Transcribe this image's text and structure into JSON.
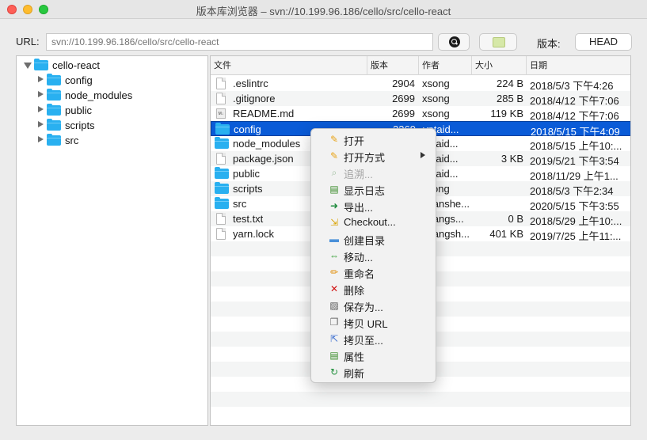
{
  "window": {
    "title": "版本库浏览器 – svn://10.199.96.186/cello/src/cello-react"
  },
  "toolbar": {
    "url_label": "URL:",
    "url_placeholder": "svn://10.199.96.186/cello/src/cello-react",
    "version_label": "版本:",
    "version_value": "HEAD"
  },
  "tree": {
    "root": "cello-react",
    "children": [
      "config",
      "node_modules",
      "public",
      "scripts",
      "src"
    ]
  },
  "list": {
    "columns": [
      "文件",
      "版本",
      "作者",
      "大小",
      "日期"
    ],
    "rows": [
      {
        "name": ".eslintrc",
        "rev": "2904",
        "author": "xsong",
        "size": "224 B",
        "date": "2018/5/3 下午4:26",
        "type": "file"
      },
      {
        "name": ".gitignore",
        "rev": "2699",
        "author": "xsong",
        "size": "285 B",
        "date": "2018/4/12 下午7:06",
        "type": "file"
      },
      {
        "name": "README.md",
        "rev": "2699",
        "author": "xsong",
        "size": "119 KB",
        "date": "2018/4/12 下午7:06",
        "type": "md"
      },
      {
        "name": "config",
        "rev": "3369",
        "author": "yptaid...",
        "size": "",
        "date": "2018/5/15 下午4:09",
        "type": "folder"
      },
      {
        "name": "node_modules",
        "rev": "",
        "author": "yptaid...",
        "size": "",
        "date": "2018/5/15 上午10:...",
        "type": "folder"
      },
      {
        "name": "package.json",
        "rev": "",
        "author": "yptaid...",
        "size": "3 KB",
        "date": "2019/5/21 下午3:54",
        "type": "file"
      },
      {
        "name": "public",
        "rev": "",
        "author": "yptaid...",
        "size": "",
        "date": "2018/11/29 上午1...",
        "type": "folder"
      },
      {
        "name": "scripts",
        "rev": "",
        "author": "xsong",
        "size": "",
        "date": "2018/5/3 下午2:34",
        "type": "folder"
      },
      {
        "name": "src",
        "rev": "",
        "author": "zhanshe...",
        "size": "",
        "date": "2020/5/15 下午3:55",
        "type": "folder"
      },
      {
        "name": "test.txt",
        "rev": "",
        "author": "zhangs...",
        "size": "0 B",
        "date": "2018/5/29 上午10:...",
        "type": "file"
      },
      {
        "name": "yarn.lock",
        "rev": "",
        "author": "zhangsh...",
        "size": "401 KB",
        "date": "2019/7/25 上午11:...",
        "type": "file"
      }
    ]
  },
  "context_menu": {
    "items": [
      {
        "label": "打开",
        "icon": "open-icon",
        "glyph": "✎",
        "color": "#e8a317",
        "disabled": false,
        "submenu": false
      },
      {
        "label": "打开方式",
        "icon": "open-with-icon",
        "glyph": "✎",
        "color": "#e8a317",
        "disabled": false,
        "submenu": true
      },
      {
        "label": "追溯...",
        "icon": "blame-icon",
        "glyph": "⌕",
        "color": "#9fbf9f",
        "disabled": true,
        "submenu": false
      },
      {
        "label": "显示日志",
        "icon": "log-icon",
        "glyph": "▤",
        "color": "#3a8c2a",
        "disabled": false,
        "submenu": false
      },
      {
        "label": "导出...",
        "icon": "export-icon",
        "glyph": "➜",
        "color": "#1d8a3c",
        "disabled": false,
        "submenu": false
      },
      {
        "label": "Checkout...",
        "icon": "checkout-icon",
        "glyph": "⇲",
        "color": "#d9a300",
        "disabled": false,
        "submenu": false
      },
      {
        "label": "创建目录",
        "icon": "create-folder-icon",
        "glyph": "▬",
        "color": "#4a90d9",
        "disabled": false,
        "submenu": false
      },
      {
        "label": "移动...",
        "icon": "move-icon",
        "glyph": "⇔",
        "color": "#2e9b2e",
        "disabled": false,
        "submenu": false
      },
      {
        "label": "重命名",
        "icon": "rename-icon",
        "glyph": "✏",
        "color": "#e08a00",
        "disabled": false,
        "submenu": false
      },
      {
        "label": "删除",
        "icon": "delete-icon",
        "glyph": "✕",
        "color": "#d01010",
        "disabled": false,
        "submenu": false
      },
      {
        "label": "保存为...",
        "icon": "save-as-icon",
        "glyph": "▨",
        "color": "#555555",
        "disabled": false,
        "submenu": false
      },
      {
        "label": "拷贝 URL",
        "icon": "copy-url-icon",
        "glyph": "❐",
        "color": "#6a6a6a",
        "disabled": false,
        "submenu": false
      },
      {
        "label": "拷贝至...",
        "icon": "copy-to-icon",
        "glyph": "⇱",
        "color": "#3c6fd0",
        "disabled": false,
        "submenu": false
      },
      {
        "label": "属性",
        "icon": "properties-icon",
        "glyph": "▤",
        "color": "#3a8c2a",
        "disabled": false,
        "submenu": false
      },
      {
        "label": "刷新",
        "icon": "refresh-icon",
        "glyph": "↻",
        "color": "#1f8f3a",
        "disabled": false,
        "submenu": false
      }
    ]
  }
}
